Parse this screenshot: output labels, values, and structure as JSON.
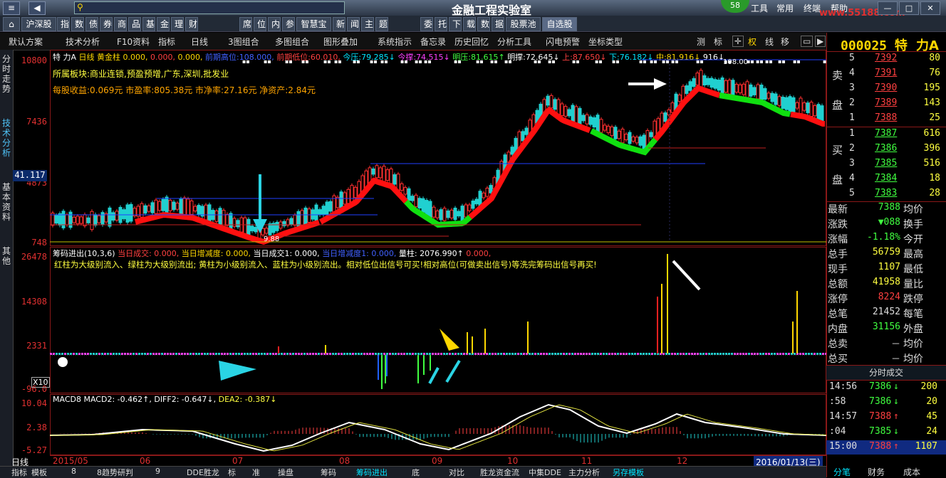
{
  "titlebar": {
    "title": "金融工程实验室",
    "badge": "58",
    "menu": [
      "工具",
      "常用",
      "终端",
      "帮助"
    ],
    "url": "www.55188.com",
    "search_placeholder": ""
  },
  "nav": {
    "groups": [
      [
        "沪深股"
      ],
      [
        "指",
        "数",
        "债",
        "券",
        "商",
        "品",
        "基",
        "金",
        "理",
        "财"
      ],
      [
        "席",
        "位",
        "内",
        "参",
        "智慧宝",
        "新",
        "闻",
        "主",
        "题"
      ],
      [
        "委",
        "托",
        "下",
        "载",
        "数",
        "据",
        "股票池",
        "自选股"
      ]
    ]
  },
  "toolbar": {
    "items": [
      "默认方案",
      "技术分析",
      "F10资料",
      "指标",
      "日线",
      "3图组合",
      "多图组合",
      "图形叠加",
      "系统指示",
      "备忘录",
      "历史回忆",
      "分析工具",
      "闪电预警",
      "坐标类型",
      "测",
      "标",
      "权",
      "线",
      "移"
    ]
  },
  "sidebar": {
    "tabs": [
      "分时走势",
      "技术分析",
      "基本资料",
      "其他"
    ]
  },
  "main_chart": {
    "yaxis": [
      "10800",
      "7436",
      "4873",
      "748"
    ],
    "price_marker": "41.117",
    "line1": [
      "特",
      "力A",
      "日线",
      "黄金柱 0.000,",
      "0.000,",
      "0.000,",
      "前期高位:108.000,",
      "前期低位:60.010,",
      "今压:79.285↓",
      "今撑:74.515↓",
      "明压:81.615↑",
      "明撑:72.645↓",
      "上:87.650↓",
      "下:76.182↓",
      "中:81.916↓",
      "916↓"
    ],
    "sector": "所属板块:商业连锁,预盈预增,广东,深圳,批发业",
    "fundamentals": "每股收益:0.069元 市盈率:805.38元 市净率:27.16元 净资产:2.84元",
    "high_label": "108.00",
    "low_label": "9.88"
  },
  "chips": {
    "title": "筹码进出(10,3,6)",
    "vals": [
      "当日成交: 0.000,",
      "当日增减度: 0.000,",
      "当日成交1: 0.000,",
      "当日增减度1: 0.000,",
      "量柱: 2076.990↑",
      "0.000,"
    ],
    "note": "红柱为大级别流入、绿柱为大级别流出; 黄柱为小级别流入、蓝柱为小级别流出。相对低位出信号可买!相对高位(可做卖出信号)等洗完筹码出信号再买!",
    "yaxis": [
      "26478",
      "14308",
      "2331",
      "-96.0"
    ],
    "xmult": "X10"
  },
  "macd": {
    "line": [
      "MACD8",
      "MACD2: -0.462↑,",
      "DIFF2: -0.647↓,",
      "DEA2: -0.387↓"
    ],
    "yaxis": [
      "10.04",
      "2.38",
      "-5.27"
    ]
  },
  "xaxis": {
    "labels": [
      "2015/05",
      "06",
      "07",
      "08",
      "09",
      "10",
      "11",
      "12"
    ],
    "date": "2016/01/13(三)",
    "period": "日线"
  },
  "bottom_tabs": [
    "指标",
    "模板",
    "8",
    "8趋势研判",
    "9",
    "DDE胜龙",
    "标",
    "准",
    "操盘",
    "筹码",
    "筹码进出",
    "底",
    "对比",
    "胜龙资金流",
    "中集DDE",
    "主力分析",
    "另存模板"
  ],
  "quote": {
    "code": "000025 特",
    "name": "力A",
    "sell_label": [
      "卖",
      "盘"
    ],
    "buy_label": [
      "买",
      "盘"
    ],
    "asks": [
      {
        "lvl": "5",
        "price": "7392",
        "vol": "80"
      },
      {
        "lvl": "4",
        "price": "7391",
        "vol": "76"
      },
      {
        "lvl": "3",
        "price": "7390",
        "vol": "195"
      },
      {
        "lvl": "2",
        "price": "7389",
        "vol": "143"
      },
      {
        "lvl": "1",
        "price": "7388",
        "vol": "25"
      }
    ],
    "bids": [
      {
        "lvl": "1",
        "price": "7387",
        "vol": "616"
      },
      {
        "lvl": "2",
        "price": "7386",
        "vol": "396"
      },
      {
        "lvl": "3",
        "price": "7385",
        "vol": "516"
      },
      {
        "lvl": "4",
        "price": "7384",
        "vol": "18"
      },
      {
        "lvl": "5",
        "price": "7383",
        "vol": "28"
      }
    ],
    "stats": [
      {
        "l": "最新",
        "v": "7388",
        "r": "均价"
      },
      {
        "l": "涨跌",
        "v": "▼088",
        "r": "换手"
      },
      {
        "l": "涨幅",
        "v": "-1.18%",
        "r": "今开"
      },
      {
        "l": "总手",
        "v": "56759",
        "r": "最高"
      },
      {
        "l": "现手",
        "v": "1107",
        "r": "最低"
      },
      {
        "l": "总额",
        "v": "41958",
        "r": "量比"
      },
      {
        "l": "涨停",
        "v": "8224",
        "r": "跌停"
      },
      {
        "l": "总笔",
        "v": "21452",
        "r": "每笔"
      },
      {
        "l": "内盘",
        "v": "31156",
        "r": "外盘"
      },
      {
        "l": "总卖",
        "v": "－",
        "r": "均价"
      },
      {
        "l": "总买",
        "v": "－",
        "r": "均价"
      }
    ],
    "ticks_title": "分时成交",
    "ticks": [
      {
        "t": "14:56",
        "p": "7386",
        "d": "down",
        "v": "200"
      },
      {
        "t": ":58",
        "p": "7386",
        "d": "down",
        "v": "20"
      },
      {
        "t": "14:57",
        "p": "7388",
        "d": "up",
        "v": "45"
      },
      {
        "t": ":04",
        "p": "7385",
        "d": "down",
        "v": "24"
      },
      {
        "t": "15:00",
        "p": "7388",
        "d": "up",
        "v": "1107"
      }
    ],
    "bottom_tabs": [
      "分笔",
      "财务",
      "成本"
    ]
  }
}
